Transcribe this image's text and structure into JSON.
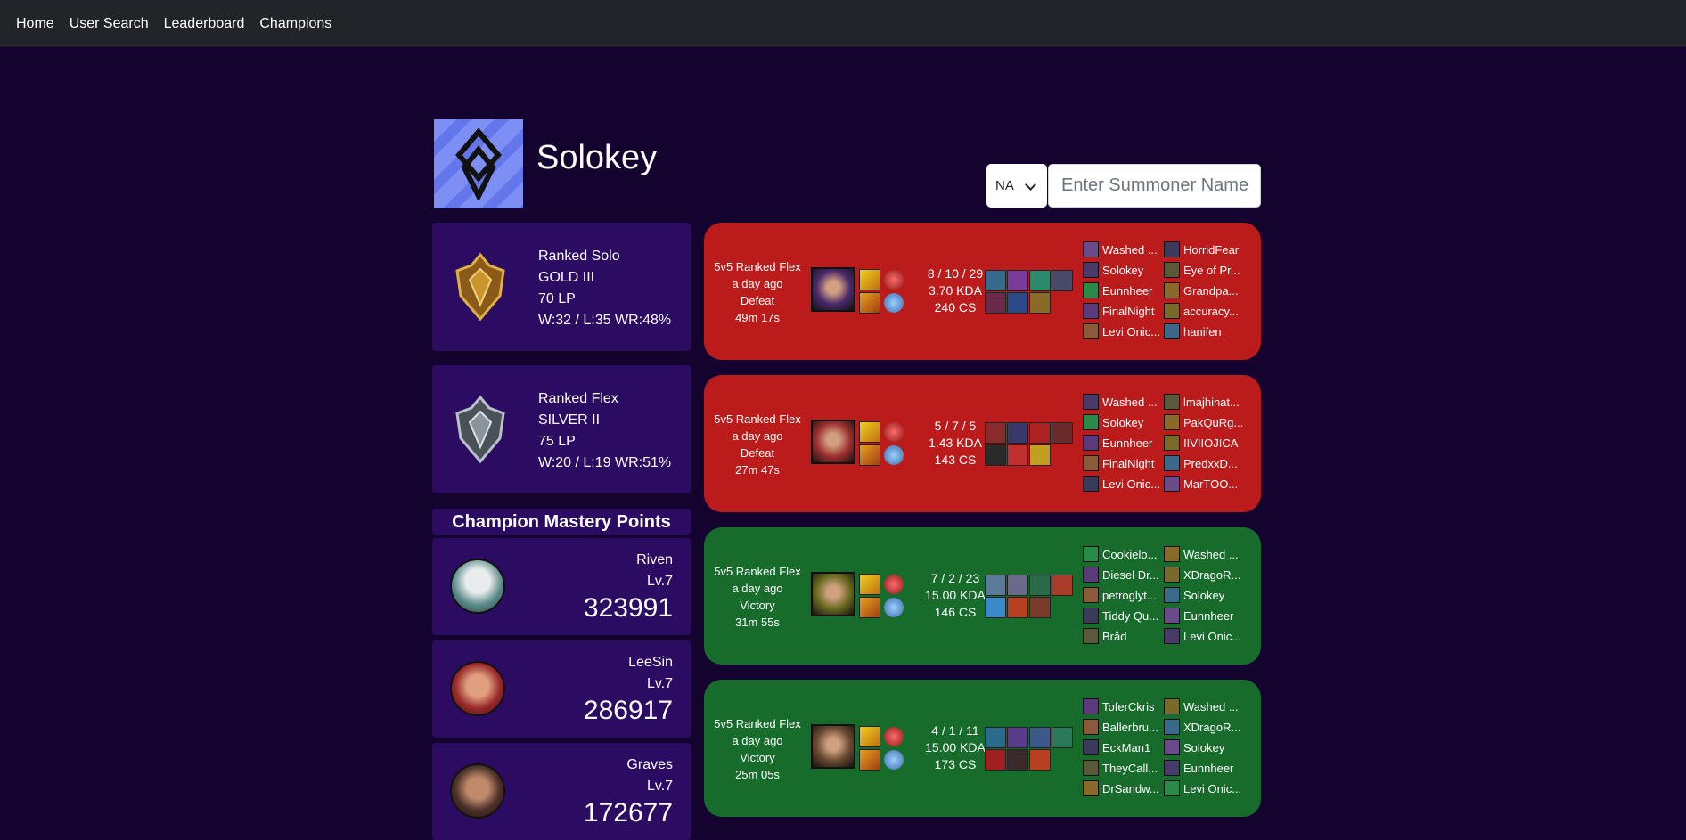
{
  "nav": {
    "items": [
      "Home",
      "User Search",
      "Leaderboard",
      "Champions"
    ]
  },
  "profile": {
    "name": "Solokey",
    "icon": "ranked-emblem-icon"
  },
  "search": {
    "region": "NA",
    "placeholder": "Enter Summoner Name"
  },
  "ranked": [
    {
      "queue": "Ranked Solo",
      "tier": "GOLD III",
      "lp": "70 LP",
      "record": "W:32 / L:35 WR:48%",
      "emblem": "gold-emblem-icon",
      "color": "#c9952c"
    },
    {
      "queue": "Ranked Flex",
      "tier": "SILVER II",
      "lp": "75 LP",
      "record": "W:20 / L:19 WR:51%",
      "emblem": "silver-emblem-icon",
      "color": "#9aa3ab"
    }
  ],
  "mastery": {
    "title": "Champion Mastery Points",
    "champions": [
      {
        "name": "Riven",
        "level": "Lv.7",
        "points": "323991",
        "color": "#b8c2c0"
      },
      {
        "name": "LeeSin",
        "level": "Lv.7",
        "points": "286917",
        "color": "#9a3030"
      },
      {
        "name": "Graves",
        "level": "Lv.7",
        "points": "172677",
        "color": "#5a4038"
      }
    ]
  },
  "matches": [
    {
      "result": "defeat",
      "queue": "5v5 Ranked Flex",
      "when": "a day ago",
      "outcome": "Defeat",
      "duration": "49m 17s",
      "kda_line": "8 / 10 / 29",
      "kda": "3.70 KDA",
      "cs": "240 CS",
      "champ_color": "#4a2a6a",
      "team1": [
        "Washed ...",
        "Solokey",
        "Eunnheer",
        "FinalNight",
        "Levi Onic..."
      ],
      "team2": [
        "HorridFear",
        "Eye of Pr...",
        "Grandpa...",
        "accuracy...",
        "hanifen"
      ]
    },
    {
      "result": "defeat",
      "queue": "5v5 Ranked Flex",
      "when": "a day ago",
      "outcome": "Defeat",
      "duration": "27m 47s",
      "kda_line": "5 / 7 / 5",
      "kda": "1.43 KDA",
      "cs": "143 CS",
      "champ_color": "#a03030",
      "team1": [
        "Washed ...",
        "Solokey",
        "Eunnheer",
        "FinalNight",
        "Levi Onic..."
      ],
      "team2": [
        "lmajhinat...",
        "PakQuRg...",
        "IIVIIOJICA",
        "PredxxD...",
        "MarTOO..."
      ]
    },
    {
      "result": "victory",
      "queue": "5v5 Ranked Flex",
      "when": "a day ago",
      "outcome": "Victory",
      "duration": "31m 55s",
      "kda_line": "7 / 2 / 23",
      "kda": "15.00 KDA",
      "cs": "146 CS",
      "champ_color": "#6a6a20",
      "team1": [
        "Cookielo...",
        "Diesel Dr...",
        "petroglyt...",
        "Tiddy Qu...",
        "Bråd"
      ],
      "team2": [
        "Washed ...",
        "XDragoR...",
        "Solokey",
        "Eunnheer",
        "Levi Onic..."
      ]
    },
    {
      "result": "victory",
      "queue": "5v5 Ranked Flex",
      "when": "a day ago",
      "outcome": "Victory",
      "duration": "25m 05s",
      "kda_line": "4 / 1 / 11",
      "kda": "15.00 KDA",
      "cs": "173 CS",
      "champ_color": "#6a4a30",
      "team1": [
        "ToferCkris",
        "Ballerbru...",
        "EckMan1",
        "TheyCall...",
        "DrSandw..."
      ],
      "team2": [
        "Washed ...",
        "XDragoR...",
        "Solokey",
        "Eunnheer",
        "Levi Onic..."
      ]
    }
  ]
}
